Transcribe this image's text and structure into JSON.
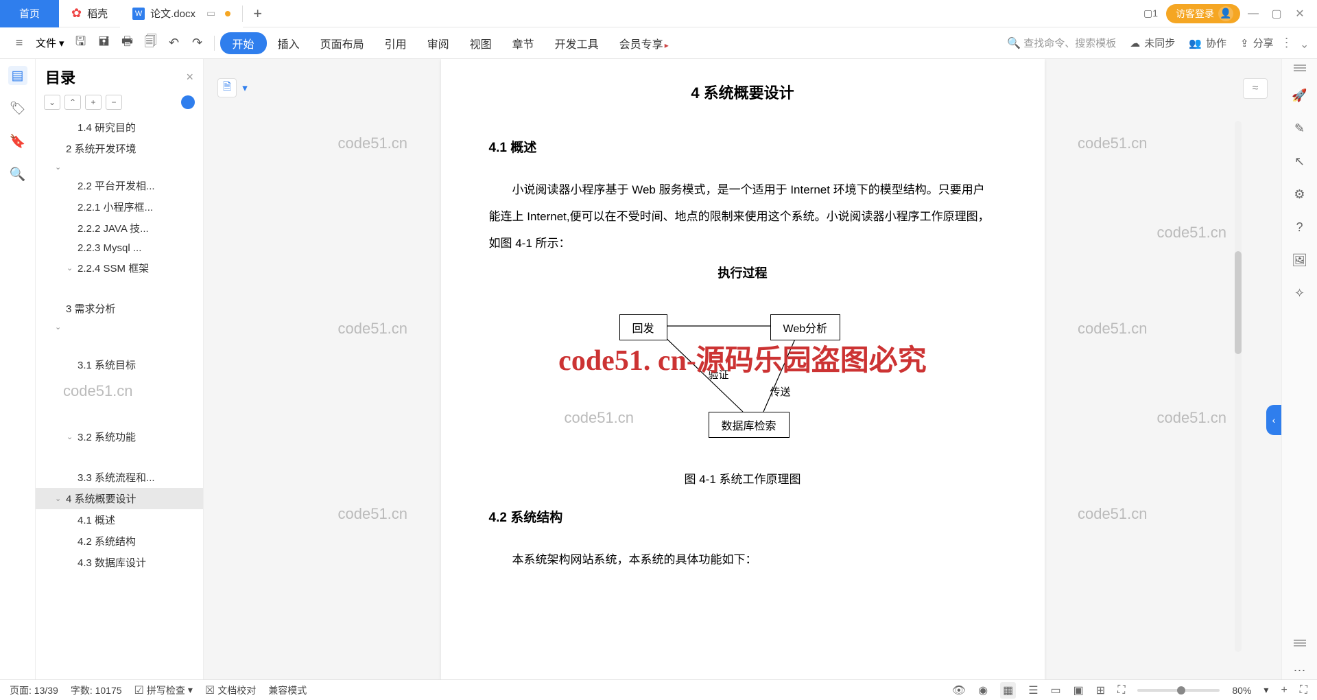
{
  "tabs": {
    "home": "首页",
    "daoke": "稻壳",
    "doc": "论文.docx",
    "add": "+"
  },
  "title_right": {
    "counter": "1",
    "login": "访客登录"
  },
  "toolbar": {
    "file": "文件",
    "menus": [
      "开始",
      "插入",
      "页面布局",
      "引用",
      "审阅",
      "视图",
      "章节",
      "开发工具",
      "会员专享"
    ],
    "search_placeholder": "查找命令、搜索模板",
    "cloud": "未同步",
    "collab": "协作",
    "share": "分享"
  },
  "toc": {
    "title": "目录",
    "items": [
      {
        "text": "1.4 研究目的",
        "lvl": "l2",
        "chev": ""
      },
      {
        "text": "2  系统开发环境",
        "lvl": "l1",
        "chev": ""
      },
      {
        "text": "",
        "lvl": "l1",
        "chev": "⌄"
      },
      {
        "text": "2.2  平台开发相...",
        "lvl": "l2",
        "chev": ""
      },
      {
        "text": "2.2.1 小程序框...",
        "lvl": "l2",
        "chev": ""
      },
      {
        "text": "2.2.2 JAVA 技...",
        "lvl": "l2",
        "chev": ""
      },
      {
        "text": "2.2.3   Mysql ...",
        "lvl": "l2",
        "chev": ""
      },
      {
        "text": "2.2.4 SSM 框架",
        "lvl": "l2",
        "chev": "⌄"
      },
      {
        "text": "3  需求分析",
        "lvl": "l1",
        "chev": ""
      },
      {
        "text": "",
        "lvl": "l1",
        "chev": "⌄"
      },
      {
        "text": "3.1 系统目标",
        "lvl": "l2",
        "chev": ""
      },
      {
        "text": "3.2 系统功能",
        "lvl": "l2",
        "chev": "⌄"
      },
      {
        "text": "3.3 系统流程和...",
        "lvl": "l2",
        "chev": ""
      },
      {
        "text": "4 系统概要设计",
        "lvl": "l1",
        "chev": "⌄",
        "active": true
      },
      {
        "text": "4.1  概述",
        "lvl": "l2",
        "chev": ""
      },
      {
        "text": "4.2  系统结构",
        "lvl": "l2",
        "chev": ""
      },
      {
        "text": "4.3 数据库设计",
        "lvl": "l2",
        "chev": ""
      }
    ],
    "wm": "code51.cn"
  },
  "doc": {
    "h2": "4 系统概要设计",
    "h3a": "4.1   概述",
    "p1": "小说阅读器小程序基于 Web 服务模式，是一个适用于 Internet 环境下的模型结构。只要用户能连上 Internet,便可以在不受时间、地点的限制来使用这个系统。小说阅读器小程序工作原理图，如图 4-1 所示：",
    "diag_title": "执行过程",
    "box_hf": "回发",
    "box_web": "Web分析",
    "lbl_verify": "验证",
    "lbl_send": "传送",
    "box_db": "数据库检索",
    "caption": "图 4-1    系统工作原理图",
    "h3b": "4.2   系统结构",
    "p2": "本系统架构网站系统，本系统的具体功能如下：",
    "big_wm": "code51. cn-源码乐园盗图必究",
    "wm": "code51.cn"
  },
  "status": {
    "page": "页面: 13/39",
    "words": "字数: 10175",
    "spell": "拼写检查",
    "proof": "文档校对",
    "compat": "兼容模式",
    "zoom": "80%"
  }
}
